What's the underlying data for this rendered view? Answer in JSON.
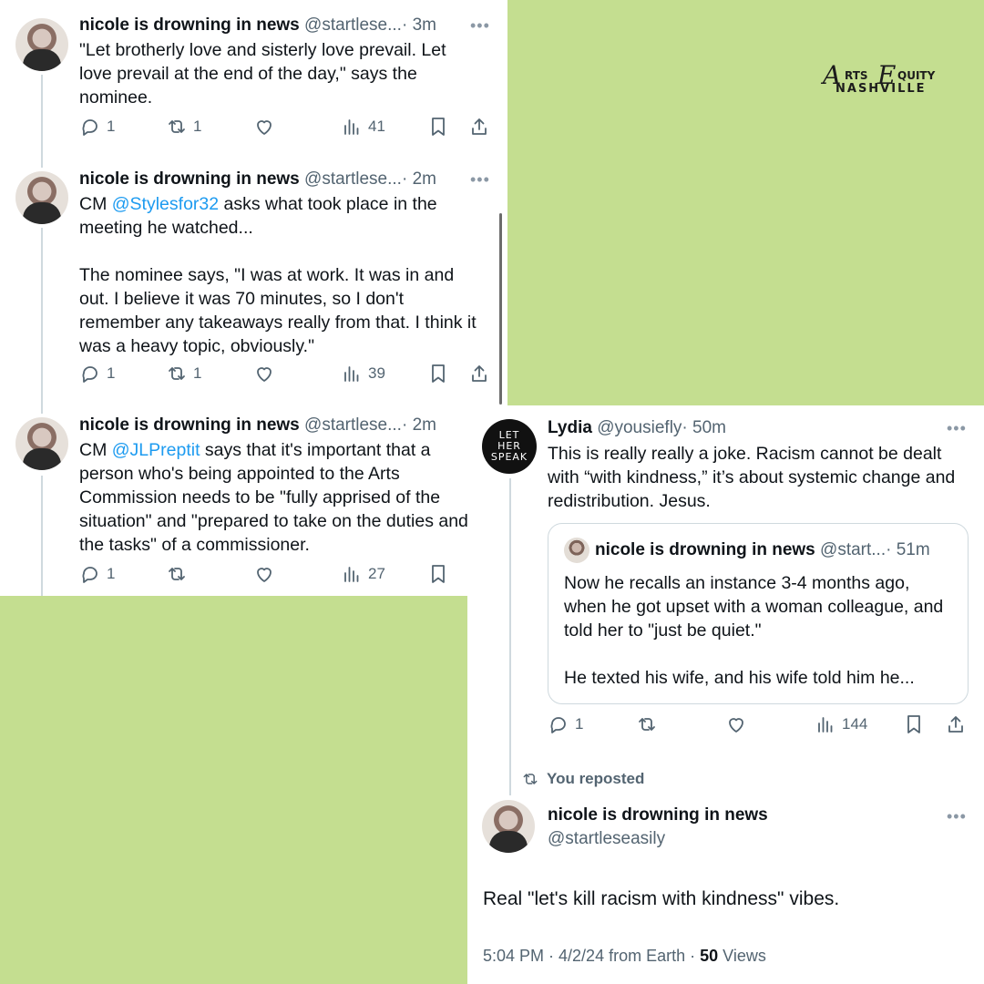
{
  "brand": {
    "logo_main": "Arts Equity",
    "logo_sub": "NASHVILLE"
  },
  "tweets": [
    {
      "name": "nicole is drowning in news",
      "handle": "@startlese...",
      "time": "· 3m",
      "text": [
        "\"Let brotherly love and sisterly love prevail. Let love prevail at the end of the day,\" says the nominee."
      ],
      "replies": "1",
      "reposts": "1",
      "views": "41"
    },
    {
      "name": "nicole is drowning in news",
      "handle": "@startlese...",
      "time": "· 2m",
      "text_prefix": "CM ",
      "mention": "@Stylesfor32",
      "text_suffix": " asks what took place in the meeting he watched...",
      "text2": "The nominee says, \"I was at work. It was in and out. I believe it was 70 minutes, so I don't remember any takeaways really from that. I think it was a heavy topic, obviously.\"",
      "replies": "1",
      "reposts": "1",
      "views": "39"
    },
    {
      "name": "nicole is drowning in news",
      "handle": "@startlese...",
      "time": "· 2m",
      "text_prefix": "CM ",
      "mention": "@JLPreptit",
      "text_suffix": " says that it's important that a person who's being appointed to the Arts Commission needs to be \"fully apprised of the situation\" and \"prepared to take on the duties and the tasks\" of a commissioner.",
      "replies": "1",
      "reposts": "",
      "views": "27"
    }
  ],
  "lydia": {
    "avatar_text": [
      "LET",
      "HER",
      "SPEAK"
    ],
    "name": "Lydia",
    "handle": "@yousiefly",
    "time": "· 50m",
    "text": "This is really really a joke. Racism cannot be dealt with “with kindness,” it’s about systemic change and redistribution. Jesus.",
    "replies": "1",
    "views": "144",
    "quote": {
      "name": "nicole is drowning in news",
      "handle": "@start...",
      "time": "· 51m",
      "text1": "Now he recalls an instance 3-4 months ago, when he got upset with a woman colleague, and told her to \"just be quiet.\"",
      "text2": "He texted his wife, and his wife told him he..."
    }
  },
  "repost": {
    "label": "You reposted",
    "name": "nicole is drowning in news",
    "handle": "@startleseasily",
    "text": "Real \"let's kill racism with kindness\" vibes.",
    "meta_time": "5:04 PM · 4/2/24 from Earth · ",
    "meta_views_count": "50",
    "meta_views_label": " Views"
  },
  "icons": [
    "reply-icon",
    "repost-icon",
    "like-icon",
    "views-icon",
    "bookmark-icon",
    "share-icon",
    "more-icon"
  ],
  "colors": {
    "background": "#c4de90",
    "mention": "#1d9bf0",
    "muted": "#536471",
    "text": "#0f1419"
  }
}
